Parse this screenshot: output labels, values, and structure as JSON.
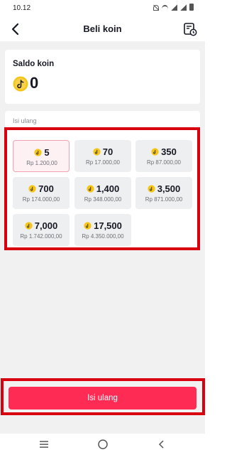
{
  "status_bar": {
    "time": "10.12"
  },
  "header": {
    "title": "Beli koin"
  },
  "balance": {
    "label": "Saldo koin",
    "value": "0"
  },
  "options": {
    "label": "Isi ulang",
    "items": [
      {
        "amount": "5",
        "price": "Rp 1.200,00",
        "selected": true
      },
      {
        "amount": "70",
        "price": "Rp 17.000,00"
      },
      {
        "amount": "350",
        "price": "Rp 87.000,00"
      },
      {
        "amount": "700",
        "price": "Rp 174.000,00"
      },
      {
        "amount": "1,400",
        "price": "Rp 348.000,00"
      },
      {
        "amount": "3,500",
        "price": "Rp 871.000,00"
      },
      {
        "amount": "7,000",
        "price": "Rp 1.742.000,00"
      },
      {
        "amount": "17,500",
        "price": "Rp 4.350.000,00"
      }
    ]
  },
  "cta": {
    "label": "Isi ulang"
  },
  "colors": {
    "accent": "#fe2c55",
    "coin": "#f5c518",
    "highlight": "#d8000f",
    "background": "#f1f1f2"
  },
  "icons": [
    "back-arrow-icon",
    "history-icon",
    "coin-icon",
    "menu-icon",
    "home-icon",
    "back-nav-icon"
  ]
}
